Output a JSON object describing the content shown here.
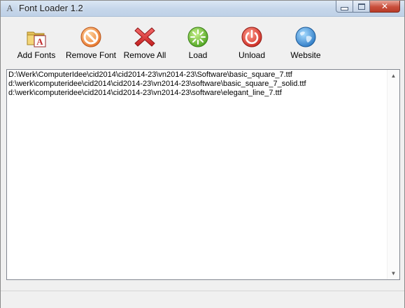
{
  "window": {
    "title": "Font Loader 1.2",
    "app_icon": "A"
  },
  "caption": {
    "minimize_icon": "minimize-icon",
    "maximize_icon": "maximize-icon",
    "close_glyph": "✕"
  },
  "toolbar": {
    "buttons": [
      {
        "label": "Add Fonts",
        "icon": "add-fonts-icon"
      },
      {
        "label": "Remove Font",
        "icon": "remove-icon"
      },
      {
        "label": "Remove All",
        "icon": "remove-all-icon"
      },
      {
        "label": "Load",
        "icon": "load-icon"
      },
      {
        "label": "Unload",
        "icon": "power-icon"
      },
      {
        "label": "Website",
        "icon": "globe-icon"
      }
    ]
  },
  "font_list": {
    "items": [
      "D:\\Werk\\ComputerIdee\\cid2014\\cid2014-23\\vn2014-23\\Software\\basic_square_7.ttf",
      "d:\\werk\\computeridee\\cid2014\\cid2014-23\\vn2014-23\\software\\basic_square_7_solid.ttf",
      "d:\\werk\\computeridee\\cid2014\\cid2014-23\\vn2014-23\\software\\elegant_line_7.ttf"
    ]
  },
  "colors": {
    "close_button": "#c94f3c",
    "titlebar": "#c5d6ea",
    "load_green": "#5ab82a",
    "unload_red": "#d9332b",
    "website_blue": "#3b8fd6"
  }
}
